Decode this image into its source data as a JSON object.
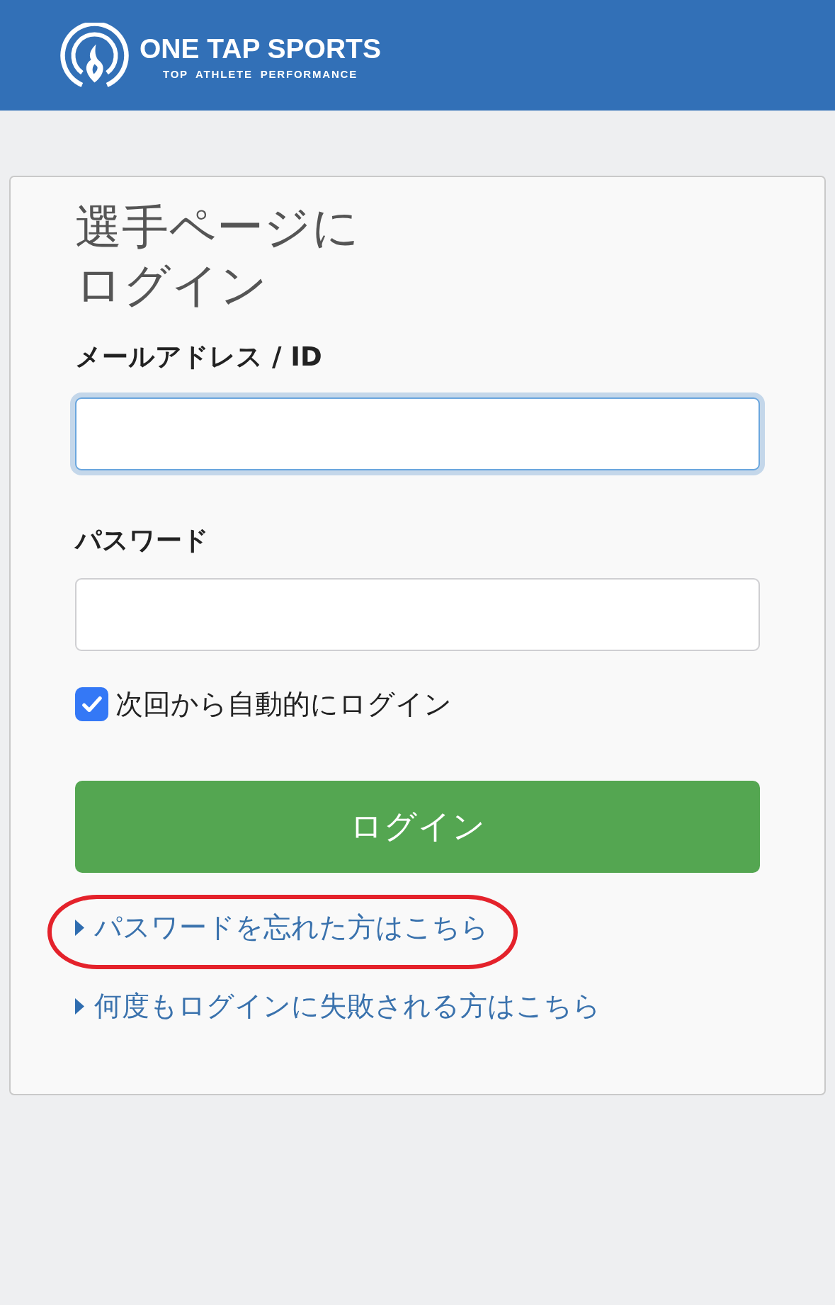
{
  "header": {
    "logo_title": "ONE TAP SPORTS",
    "logo_tagline": "TOP ATHLETE PERFORMANCE"
  },
  "login_card": {
    "title": "選手ページにログイン",
    "fields": [
      {
        "label": "メールアドレス / ID",
        "focused": true
      },
      {
        "label": "パスワード",
        "focused": false
      }
    ],
    "remember_me": {
      "label": "次回から自動的にログイン",
      "checked": true
    },
    "login_button": {
      "label": "ログイン"
    },
    "links": [
      {
        "label": "パスワードを忘れた方はこちら",
        "highlighted": true
      },
      {
        "label": "何度もログインに失敗される方はこちら",
        "highlighted": false
      }
    ]
  }
}
